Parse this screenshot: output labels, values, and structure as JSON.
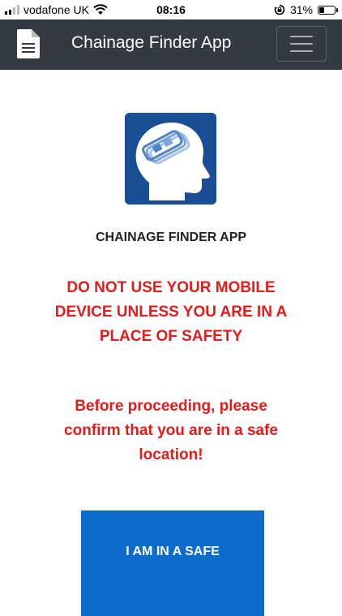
{
  "status_bar": {
    "carrier": "vodafone UK",
    "time": "08:16",
    "battery_text": "31%",
    "battery_level": 0.31,
    "icons": [
      "signal-icon",
      "wifi-icon",
      "rotation-lock-icon",
      "battery-icon"
    ]
  },
  "navbar": {
    "title": "Chainage Finder App",
    "brand_icon": "document-icon",
    "menu_icon": "hamburger-menu-icon"
  },
  "main": {
    "logo_icon": "head-with-chainage-logo-icon",
    "heading": "CHAINAGE FINDER APP",
    "warning": "DO NOT USE YOUR MOBILE DEVICE UNLESS YOU ARE IN A PLACE OF SAFETY",
    "confirm": "Before proceeding, please confirm that you are in a safe location!",
    "safe_button": "I AM IN A SAFE"
  },
  "colors": {
    "navbar_bg": "#343a40",
    "warning_red": "#e21b1b",
    "button_blue": "#0c6ccc",
    "logo_blue": "#1a4e94"
  }
}
